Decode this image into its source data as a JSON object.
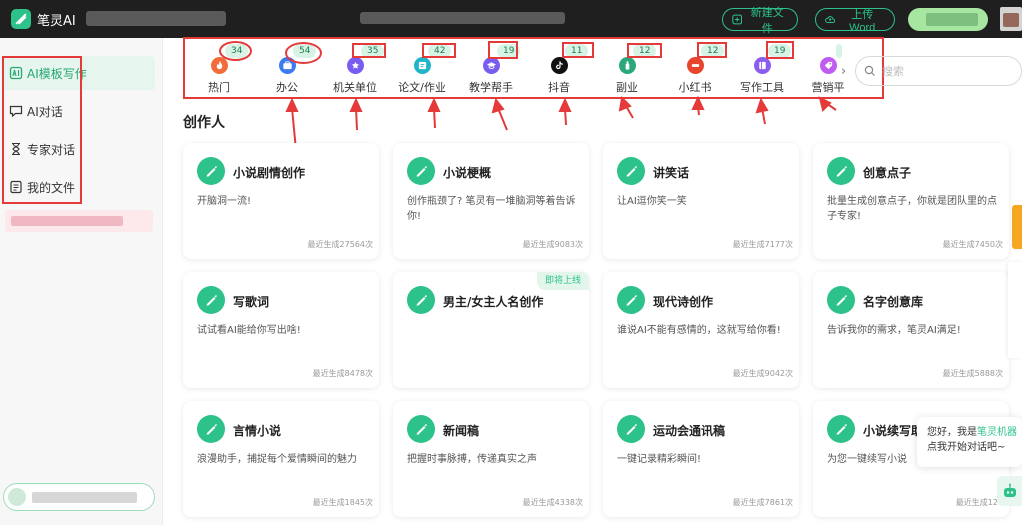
{
  "app": {
    "name": "笔灵AI"
  },
  "toolbar": {
    "new_file": "新建文件",
    "upload_word": "上传Word"
  },
  "sidebar": {
    "items": [
      {
        "label": "AI模板写作",
        "icon": "template-icon",
        "active": true
      },
      {
        "label": "AI对话",
        "icon": "chat-icon"
      },
      {
        "label": "专家对话",
        "icon": "hourglass-icon"
      },
      {
        "label": "我的文件",
        "icon": "file-icon"
      }
    ]
  },
  "categories": [
    {
      "label": "热门",
      "count": "34",
      "color": "#f26b3a"
    },
    {
      "label": "办公",
      "count": "54",
      "color": "#3d7bf0"
    },
    {
      "label": "机关单位",
      "count": "35",
      "color": "#7b5cf0"
    },
    {
      "label": "论文/作业",
      "count": "42",
      "color": "#1fb5c8"
    },
    {
      "label": "教学帮手",
      "count": "19",
      "color": "#7b5cf0"
    },
    {
      "label": "抖音",
      "count": "11",
      "color": "#111111"
    },
    {
      "label": "副业",
      "count": "12",
      "color": "#2aa87a"
    },
    {
      "label": "小红书",
      "count": "12",
      "color": "#e8452c"
    },
    {
      "label": "写作工具",
      "count": "19",
      "color": "#8a5cf0"
    },
    {
      "label": "营销平",
      "count": "",
      "color": "#c05cf0"
    }
  ],
  "search": {
    "placeholder": "搜索"
  },
  "section": {
    "title": "创作人"
  },
  "cards": [
    {
      "title": "小说剧情创作",
      "desc": "开脑洞一流!",
      "meta": "最近生成27564次"
    },
    {
      "title": "小说梗概",
      "desc": "创作瓶颈了? 笔灵有一堆脑洞等着告诉你!",
      "meta": "最近生成9083次"
    },
    {
      "title": "讲笑话",
      "desc": "让AI逗你笑一笑",
      "meta": "最近生成7177次"
    },
    {
      "title": "创意点子",
      "desc": "批量生成创意点子，你就是团队里的点子专家!",
      "meta": "最近生成7450次"
    },
    {
      "title": "写歌词",
      "desc": "试试看AI能给你写出啥!",
      "meta": "最近生成8478次"
    },
    {
      "title": "男主/女主人名创作",
      "desc": "",
      "meta": "",
      "tag": "即将上线"
    },
    {
      "title": "现代诗创作",
      "desc": "谁说AI不能有感情的，这就写给你看!",
      "meta": "最近生成9042次"
    },
    {
      "title": "名字创意库",
      "desc": "告诉我你的需求，笔灵AI满足!",
      "meta": "最近生成5888次"
    },
    {
      "title": "言情小说",
      "desc": "浪漫助手，捕捉每个爱情瞬间的魅力",
      "meta": "最近生成1845次"
    },
    {
      "title": "新闻稿",
      "desc": "把握时事脉搏，传递真实之声",
      "meta": "最近生成4338次"
    },
    {
      "title": "运动会通讯稿",
      "desc": "一键记录精彩瞬间!",
      "meta": "最近生成7861次"
    },
    {
      "title": "小说续写助",
      "desc": "为您一键续写小说",
      "meta": "最近生成120"
    }
  ],
  "chat": {
    "greeting": "您好，我是",
    "bot_name": "笔灵机器",
    "prompt": "点我开始对话吧~"
  },
  "colors": {
    "brand": "#2cc28a",
    "annotation": "#e43a3a",
    "topbar": "#1f1f1f"
  }
}
